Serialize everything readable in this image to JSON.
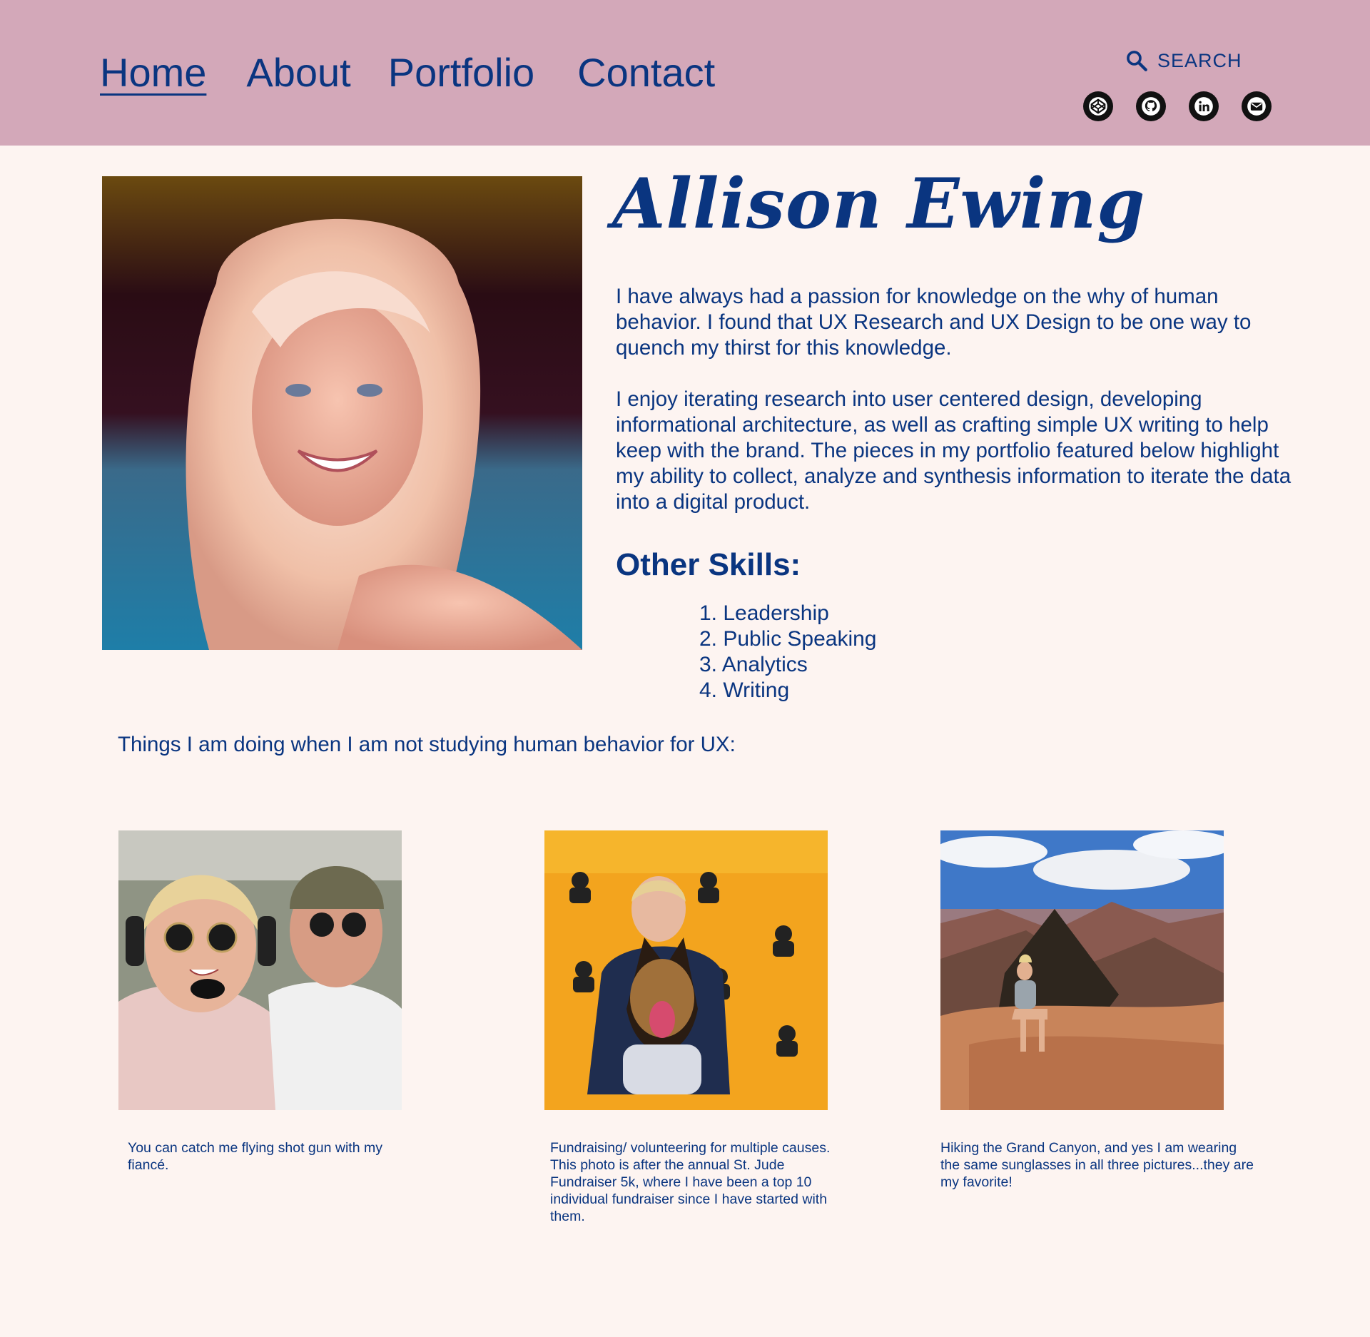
{
  "nav": {
    "items": [
      {
        "label": "Home",
        "active": true
      },
      {
        "label": "About",
        "active": false
      },
      {
        "label": "Portfolio",
        "active": false
      },
      {
        "label": "Contact",
        "active": false
      }
    ]
  },
  "search": {
    "label": "SEARCH",
    "icon": "search-icon"
  },
  "social": {
    "icons": [
      "codepen-icon",
      "github-icon",
      "linkedin-icon",
      "email-icon"
    ]
  },
  "profile": {
    "name": "Allison Ewing",
    "bio_1": "I have always had a passion for knowledge on the why of human behavior. I found that UX Research and UX Design to be one way to quench my thirst for this knowledge.",
    "bio_2": "I enjoy iterating research into user centered design, developing informational architecture, as well as crafting simple UX writing to help keep with the brand. The pieces in my portfolio featured below highlight my ability to collect, analyze and synthesis information to iterate the data into a digital product."
  },
  "skills": {
    "title": "Other Skills:",
    "items": [
      "1. Leadership",
      "2. Public Speaking",
      "3. Analytics",
      "4. Writing"
    ]
  },
  "gallery": {
    "intro": "Things I am doing when I am not studying human behavior for UX:",
    "captions": [
      "You can catch me flying shot gun with my fiancé.",
      "Fundraising/ volunteering for multiple causes. This photo is after the annual St. Jude Fundraiser 5k, where I have been a top 10 individual fundraiser since I have started with them.",
      "Hiking the Grand Canyon, and yes I am wearing the same sunglasses in all three pictures...they are my favorite!"
    ]
  },
  "colors": {
    "header_bg": "#d3a8b9",
    "page_bg": "#fdf4f1",
    "text": "#0a3580"
  }
}
